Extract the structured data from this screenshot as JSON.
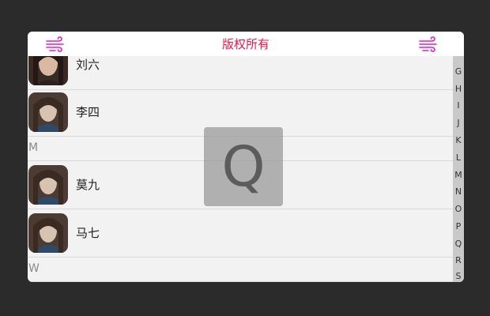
{
  "header": {
    "title": "版权所有",
    "left_icon": "wind-icon",
    "right_icon": "wind-icon"
  },
  "contacts": {
    "liu": {
      "name": "刘六"
    },
    "li": {
      "name": "李四"
    },
    "mo": {
      "name": "莫九"
    },
    "ma": {
      "name": "马七"
    }
  },
  "sections": {
    "m": "M",
    "w": "W"
  },
  "index_letters": [
    "G",
    "H",
    "I",
    "J",
    "K",
    "L",
    "M",
    "N",
    "O",
    "P",
    "Q",
    "R",
    "S"
  ],
  "overlay_letter": "Q",
  "colors": {
    "accent": "#e8194a",
    "icon": "#e020c8",
    "background": "#2b2b2b"
  }
}
